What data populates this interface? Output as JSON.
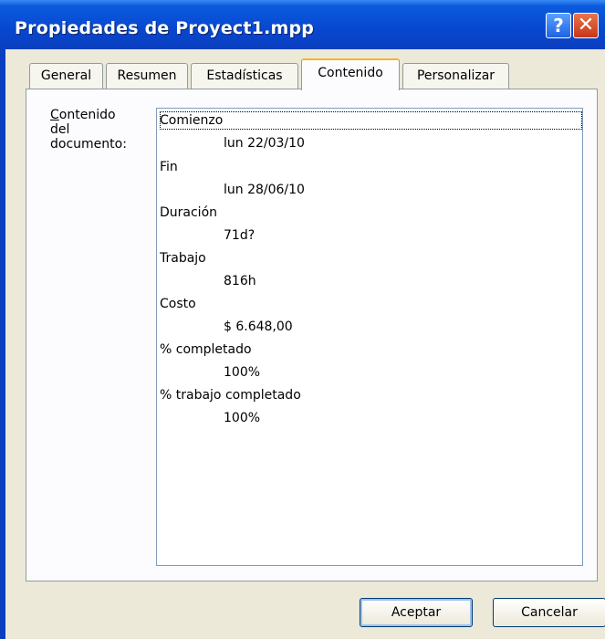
{
  "window": {
    "title": "Propiedades de Proyect1.mpp",
    "help_glyph": "?",
    "close_glyph": "✕"
  },
  "tabs": [
    {
      "label": "General"
    },
    {
      "label": "Resumen"
    },
    {
      "label": "Estadísticas"
    },
    {
      "label": "Contenido",
      "active": true
    },
    {
      "label": "Personalizar"
    }
  ],
  "content": {
    "label_first_letter": "C",
    "label_rest_line1": "ontenido",
    "label_line2": "del",
    "label_line3": "documento:",
    "items": [
      {
        "key": "Comienzo",
        "value": "lun 22/03/10"
      },
      {
        "key": "Fin",
        "value": "lun 28/06/10"
      },
      {
        "key": "Duración",
        "value": "71d?"
      },
      {
        "key": "Trabajo",
        "value": "816h"
      },
      {
        "key": "Costo",
        "value": "$ 6.648,00"
      },
      {
        "key": "% completado",
        "value": "100%"
      },
      {
        "key": "% trabajo completado",
        "value": "100%"
      }
    ]
  },
  "buttons": {
    "ok": "Aceptar",
    "cancel": "Cancelar"
  },
  "colors": {
    "titlebar": "#0a4fd8",
    "dialog_bg": "#ece9d8",
    "active_tab_accent": "#f5b331"
  }
}
